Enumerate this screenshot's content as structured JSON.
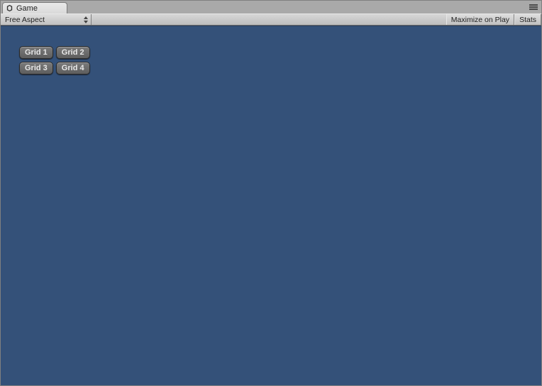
{
  "tab": {
    "title": "Game"
  },
  "toolbar": {
    "aspect_label": "Free Aspect",
    "maximize_label": "Maximize on Play",
    "stats_label": "Stats"
  },
  "grid_buttons": [
    "Grid 1",
    "Grid 2",
    "Grid 3",
    "Grid 4"
  ]
}
